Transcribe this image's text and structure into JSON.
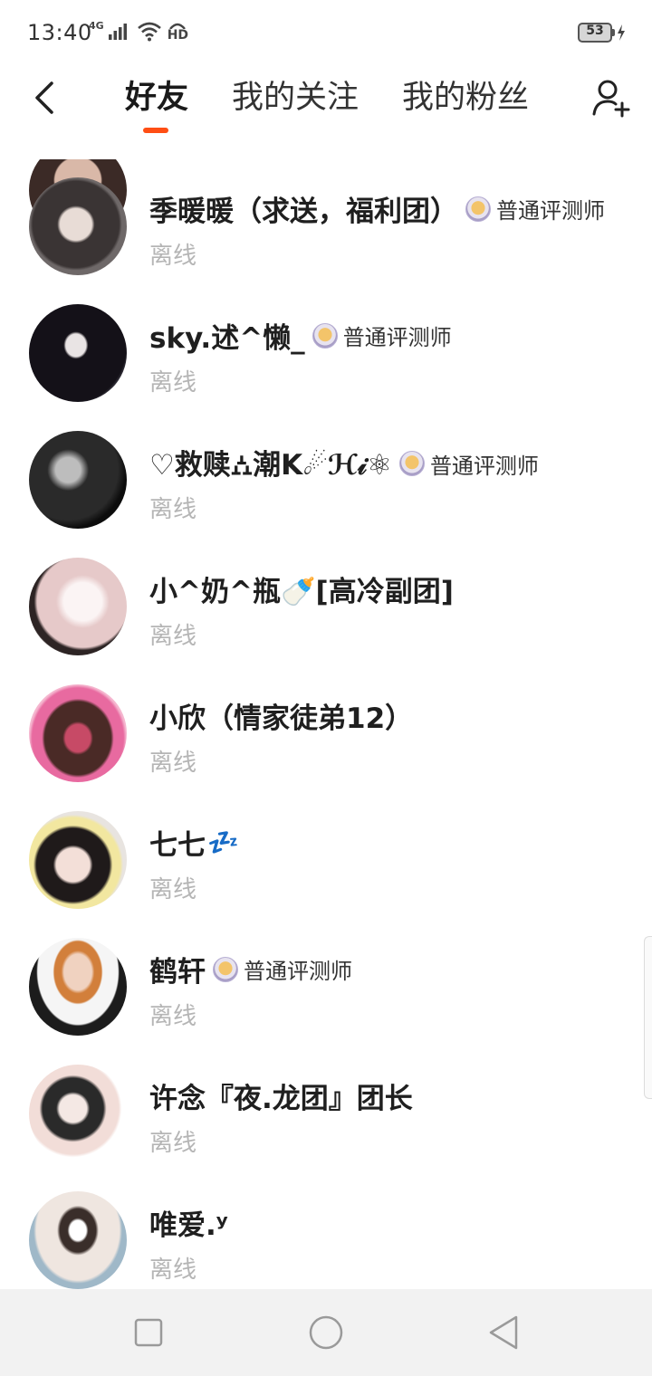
{
  "status_bar": {
    "time": "13:40",
    "network": "4G",
    "hd_label": "HD",
    "battery_level": "53"
  },
  "header": {
    "tabs": [
      {
        "label": "好友",
        "active": true
      },
      {
        "label": "我的关注",
        "active": false
      },
      {
        "label": "我的粉丝",
        "active": false
      }
    ],
    "accent_color": "#ff4e14"
  },
  "friends": [
    {
      "name": "季暖暖（求送，福利团）",
      "badge": "普通评测师",
      "status": "离线"
    },
    {
      "name": "sky.述^懒_",
      "badge": "普通评测师",
      "status": "离线"
    },
    {
      "name": "♡救赎⛼潮K☄ℋ𝒾⚛",
      "badge": "普通评测师",
      "status": "离线"
    },
    {
      "name": "小^奶^瓶🍼[高冷副团]",
      "badge": "",
      "status": "离线"
    },
    {
      "name": "小欣（情家徒弟12）",
      "badge": "",
      "status": "离线"
    },
    {
      "name": "七七",
      "emoji": "💤",
      "badge": "",
      "status": "离线"
    },
    {
      "name": "鹤轩",
      "badge": "普通评测师",
      "status": "离线"
    },
    {
      "name": "许念『夜.龙团』团长",
      "badge": "",
      "status": "离线"
    },
    {
      "name": "唯爱.ʸ",
      "badge": "",
      "status": "离线"
    }
  ],
  "icons": {
    "back": "back-arrow-icon",
    "add_friend": "add-user-icon",
    "badge": "reviewer-badge-icon",
    "nav_recent": "square-icon",
    "nav_home": "circle-icon",
    "nav_back": "triangle-back-icon"
  }
}
